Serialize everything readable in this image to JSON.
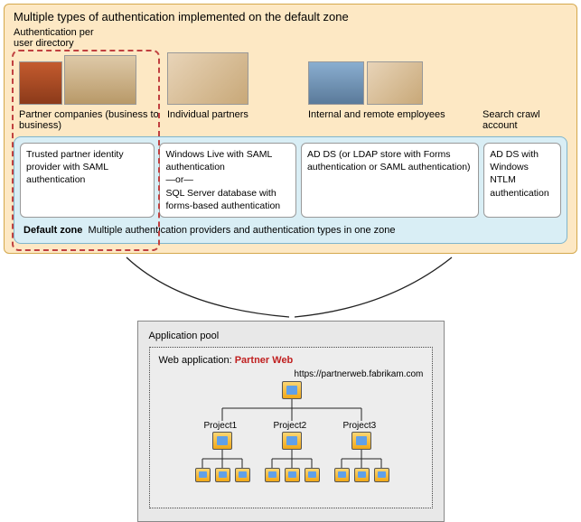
{
  "title": "Multiple types of authentication implemented on the default zone",
  "sub_title": "Authentication per\nuser directory",
  "user_groups": {
    "partner": {
      "label": "Partner companies (business to business)"
    },
    "individual": {
      "label": "Individual partners"
    },
    "internal": {
      "label": "Internal and remote employees"
    },
    "search": {
      "label": "Search crawl account"
    }
  },
  "auth_cards": {
    "partner": "Trusted partner identity provider with SAML authentication",
    "individual": "Windows Live with SAML authentication\n—or—\nSQL Server database with forms-based authentication",
    "internal": "AD DS  (or LDAP store with Forms authentication or SAML authentication)",
    "search": "AD DS with Windows NTLM authentication"
  },
  "zone": {
    "name": "Default zone",
    "desc": "Multiple authentication providers and authentication types in one zone"
  },
  "app_pool": {
    "title": "Application pool",
    "web_app_label": "Web application:",
    "web_app_name": "Partner Web",
    "url": "https://partnerweb.fabrikam.com",
    "projects": [
      "Project1",
      "Project2",
      "Project3"
    ]
  }
}
